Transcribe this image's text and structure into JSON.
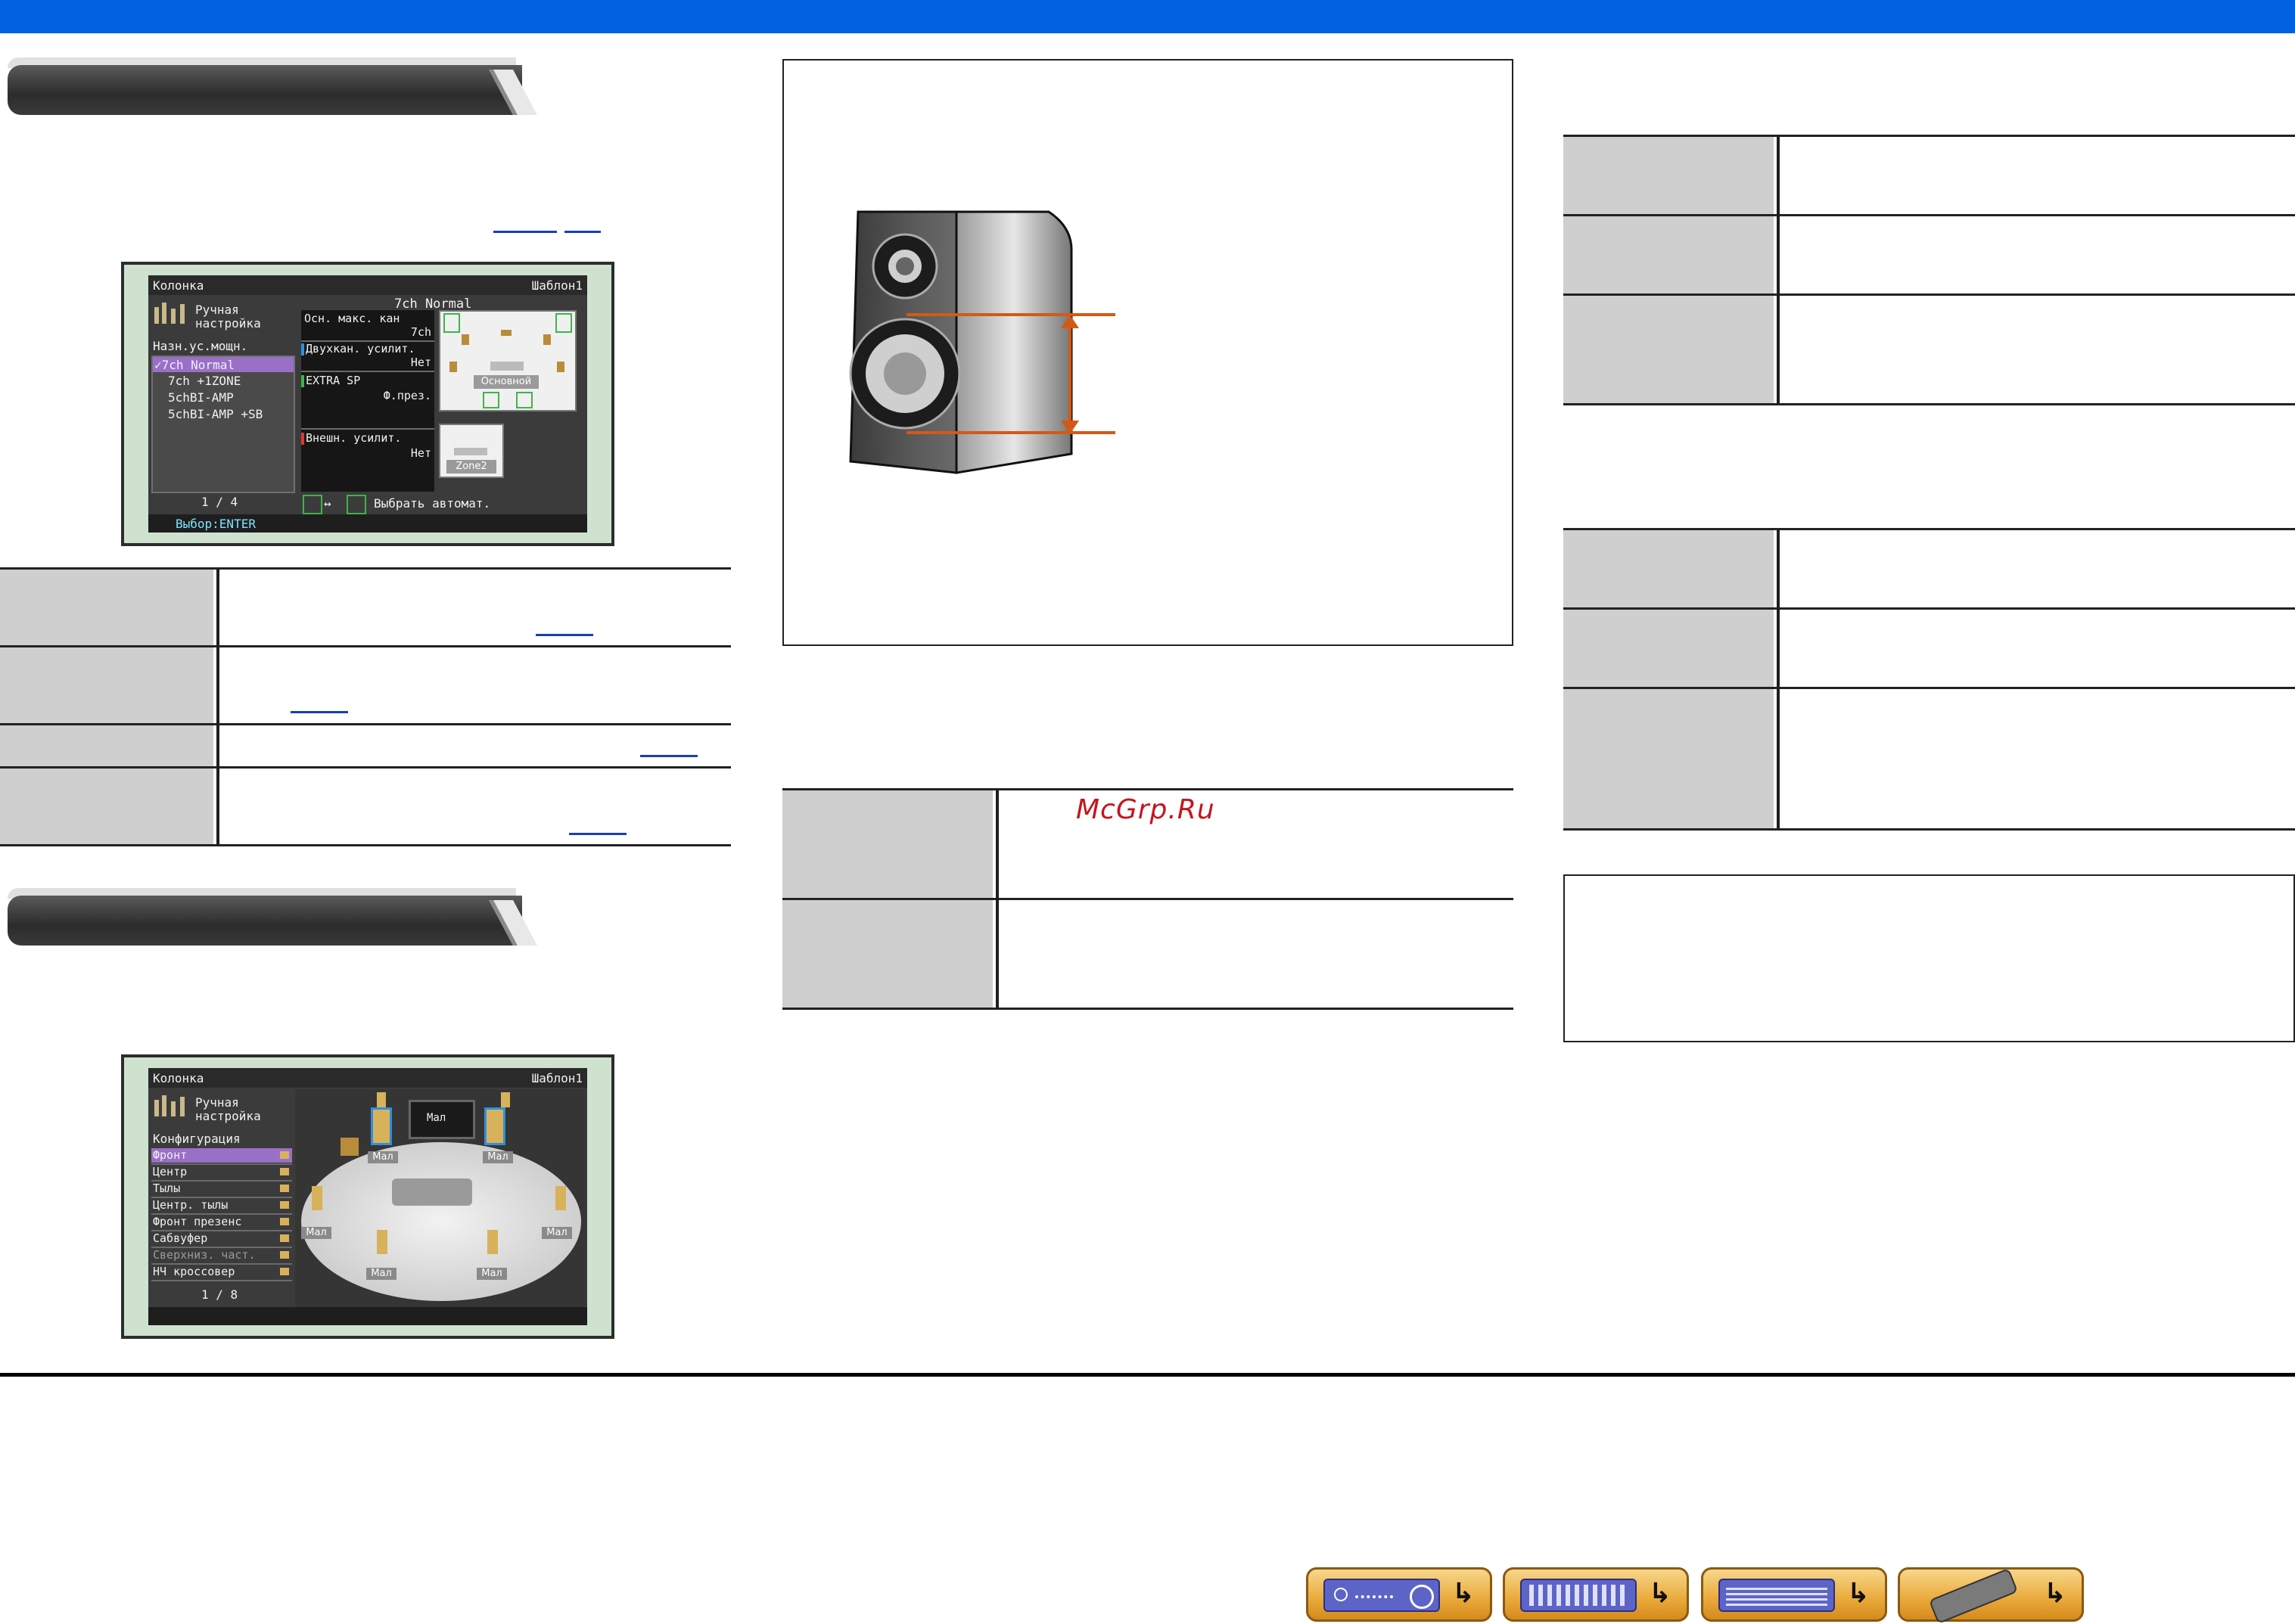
{
  "watermark": "McGrp.Ru",
  "osd1": {
    "title_left": "Колонка",
    "title_right": "Шаблон1",
    "mode_line1": "Ручная",
    "mode_line2": "настройка",
    "list_label": "Назн.ус.мощн.",
    "list_items": [
      "✓7ch Normal",
      "7ch +1ZONE",
      "5chBI-AMP",
      "5chBI-AMP +SB"
    ],
    "page": "1 / 4",
    "pattern_title": "7ch Normal",
    "params": [
      {
        "label": "Осн. макс. кан",
        "value": "7ch"
      },
      {
        "label": "Двухкан. усилит.",
        "value": "Нет"
      },
      {
        "label": "EXTRA SP",
        "value": "Ф.през."
      },
      {
        "label": "Внешн. усилит.",
        "value": "Нет"
      }
    ],
    "main_zone_label": "Основной",
    "zone2_label": "Zone2",
    "auto_select": "Выбрать автомат.",
    "footer": "Выбор:ENTER"
  },
  "osd2": {
    "title_left": "Колонка",
    "title_right": "Шаблон1",
    "mode_line1": "Ручная",
    "mode_line2": "настройка",
    "list_label": "Конфигурация",
    "list_items": [
      "Фронт",
      "Центр",
      "Тылы",
      "Центр. тылы",
      "Фронт презенс",
      "Сабвуфер",
      "Сверхниз. част.",
      "НЧ кроссовер"
    ],
    "page": "1 / 8",
    "speaker_labels": [
      "Мал",
      "Мал",
      "Мал",
      "Мал",
      "Мал",
      "Мал",
      "Мал"
    ]
  },
  "colors": {
    "top_bar": "#0061e0",
    "header": "#3a3a3a",
    "table_label_bg": "#cfcfcf",
    "link": "#1a3fb3",
    "measure_arrow": "#d35a16",
    "osd_highlight": "#9a6fc8"
  },
  "icons": [
    "receiver-front-icon",
    "receiver-rear-icon",
    "receiver-display-icon",
    "remote-control-icon"
  ]
}
